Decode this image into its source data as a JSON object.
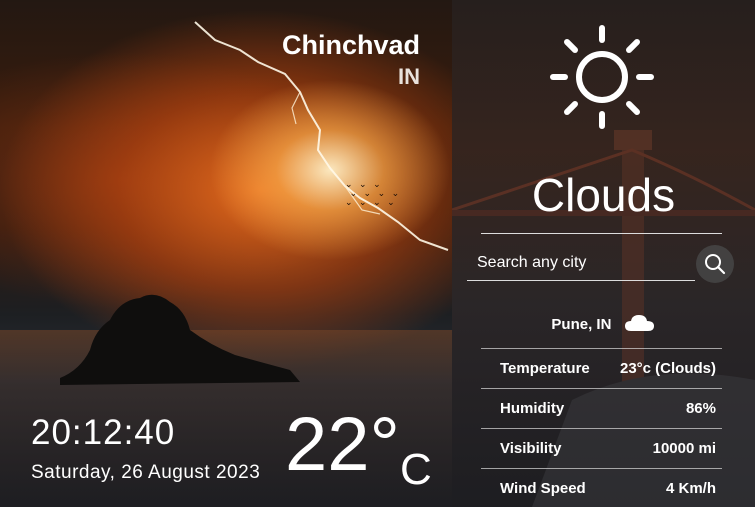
{
  "location": {
    "city": "Chinchvad",
    "country": "IN"
  },
  "clock": {
    "time": "20:12:40",
    "date": "Saturday, 26 August 2023"
  },
  "current": {
    "temp_value": "22°",
    "temp_unit": "C",
    "condition": "Clouds",
    "icon": "sun-icon"
  },
  "search": {
    "placeholder": "Search any city",
    "value": ""
  },
  "result": {
    "location_label": "Pune, IN",
    "icon": "cloud-icon",
    "rows": [
      {
        "label": "Temperature",
        "value": "23°c (Clouds)"
      },
      {
        "label": "Humidity",
        "value": "86%"
      },
      {
        "label": "Visibility",
        "value": "10000 mi"
      },
      {
        "label": "Wind Speed",
        "value": "4 Km/h"
      }
    ]
  },
  "colors": {
    "accent_fire": "#e8741f",
    "panel_dark": "#2b2522",
    "text": "#ffffff"
  }
}
